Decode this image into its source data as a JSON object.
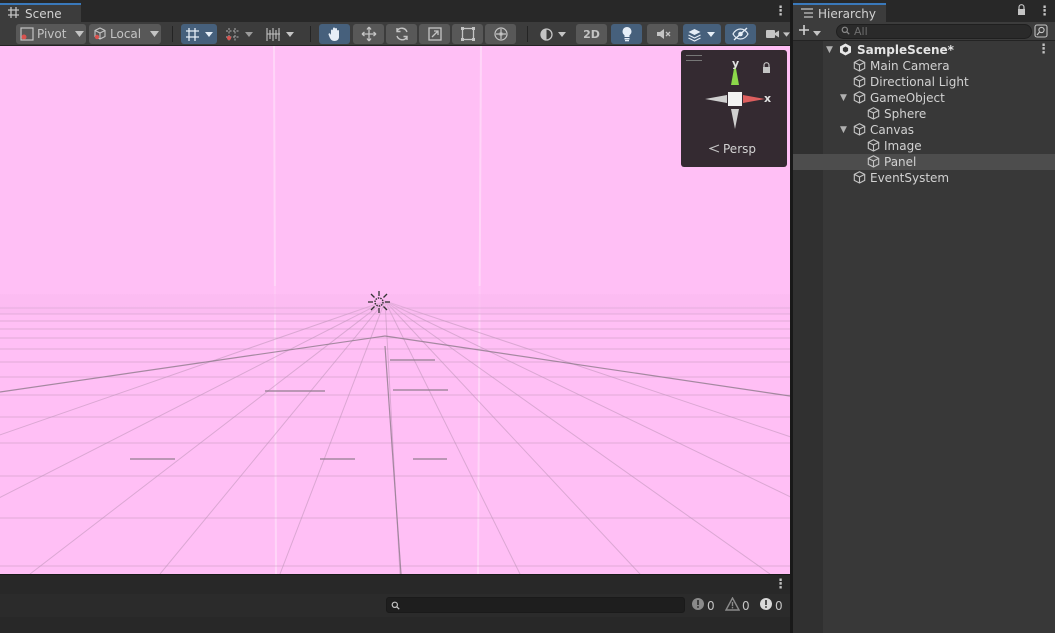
{
  "scene": {
    "tab_label": "Scene",
    "toolbar": {
      "pivot_label": "Pivot",
      "local_label": "Local",
      "mode_2d_label": "2D"
    },
    "gizmo": {
      "y_label": "y",
      "x_label": "x",
      "persp_label": "Persp"
    }
  },
  "console": {
    "search_placeholder": "",
    "errors_count": "0",
    "warnings_count": "0",
    "messages_count": "0"
  },
  "hierarchy": {
    "tab_label": "Hierarchy",
    "search_placeholder": "All",
    "items": [
      {
        "label": "SampleScene*"
      },
      {
        "label": "Main Camera"
      },
      {
        "label": "Directional Light"
      },
      {
        "label": "GameObject"
      },
      {
        "label": "Sphere"
      },
      {
        "label": "Canvas"
      },
      {
        "label": "Image"
      },
      {
        "label": "Panel"
      },
      {
        "label": "EventSystem"
      }
    ]
  }
}
